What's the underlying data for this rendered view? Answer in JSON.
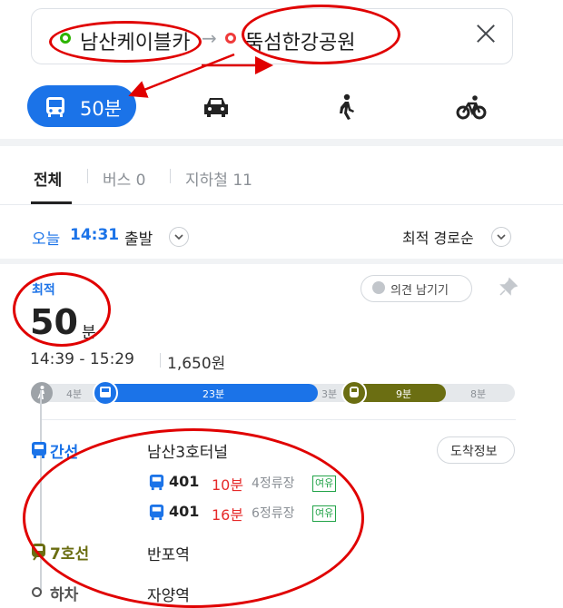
{
  "route": {
    "origin": "남산케이블카",
    "destination": "뚝섬한강공원"
  },
  "modes": {
    "transit_time": "50분"
  },
  "tabs": [
    {
      "label": "전체"
    },
    {
      "label": "버스 0"
    },
    {
      "label": "지하철 11"
    }
  ],
  "departure": {
    "today_label": "오늘",
    "time": "14:31",
    "suffix": "출발"
  },
  "sort": {
    "label": "최적 경로순"
  },
  "result": {
    "badge": "최적",
    "duration_number": "50",
    "duration_unit": "분",
    "time_range": "14:39 - 15:29",
    "fare": "1,650원",
    "feedback": "의견 남기기",
    "segments": [
      {
        "label": "4분",
        "type": "walk"
      },
      {
        "label": "23분",
        "type": "bus"
      },
      {
        "label": "3분",
        "type": "walk"
      },
      {
        "label": "9분",
        "type": "subway"
      },
      {
        "label": "8분",
        "type": "walk"
      }
    ]
  },
  "steps": {
    "bus_type": "간선",
    "bus_stop": "남산3호터널",
    "arrival_info": "도착정보",
    "buses": [
      {
        "number": "401",
        "wait": "10분",
        "stops": "4정류장",
        "seat": "여유"
      },
      {
        "number": "401",
        "wait": "16분",
        "stops": "6정류장",
        "seat": "여유"
      }
    ],
    "subway_line": "7호선",
    "subway_station": "반포역",
    "exit_label": "하차",
    "exit_station": "자양역"
  },
  "colors": {
    "accent_blue": "#1b73e8",
    "subway_olive": "#6b6e12",
    "time_red": "#e62b2b",
    "annotation_red": "#e00000"
  }
}
